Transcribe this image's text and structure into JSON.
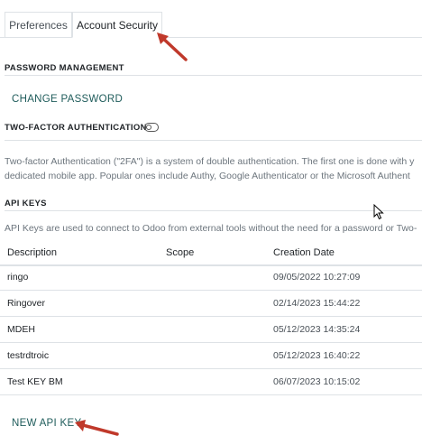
{
  "tabs": [
    {
      "label": "Preferences"
    },
    {
      "label": "Account Security"
    }
  ],
  "password_management": {
    "heading": "PASSWORD MANAGEMENT",
    "change_password_label": "CHANGE PASSWORD"
  },
  "two_factor": {
    "heading": "TWO-FACTOR AUTHENTICATION",
    "line1": "Two-factor Authentication (\"2FA\") is a system of double authentication. The first one is done with y",
    "line2": "dedicated mobile app. Popular ones include Authy, Google Authenticator or the Microsoft Authent"
  },
  "api_keys": {
    "heading": "API KEYS",
    "description": "API Keys are used to connect to Odoo from external tools without the need for a password or Two-",
    "columns": [
      "Description",
      "Scope",
      "Creation Date"
    ],
    "rows": [
      {
        "description": "ringo",
        "scope": "",
        "date": "09/05/2022 10:27:09"
      },
      {
        "description": "Ringover",
        "scope": "",
        "date": "02/14/2023 15:44:22"
      },
      {
        "description": "MDEH",
        "scope": "",
        "date": "05/12/2023 14:35:24"
      },
      {
        "description": "testrdtroic",
        "scope": "",
        "date": "05/12/2023 16:40:22"
      },
      {
        "description": "Test KEY BM",
        "scope": "",
        "date": "06/07/2023 10:15:02"
      }
    ],
    "new_key_label": "NEW API KEY"
  },
  "colors": {
    "annotation_arrow": "#c0392b",
    "link": "#1f5c5b"
  }
}
